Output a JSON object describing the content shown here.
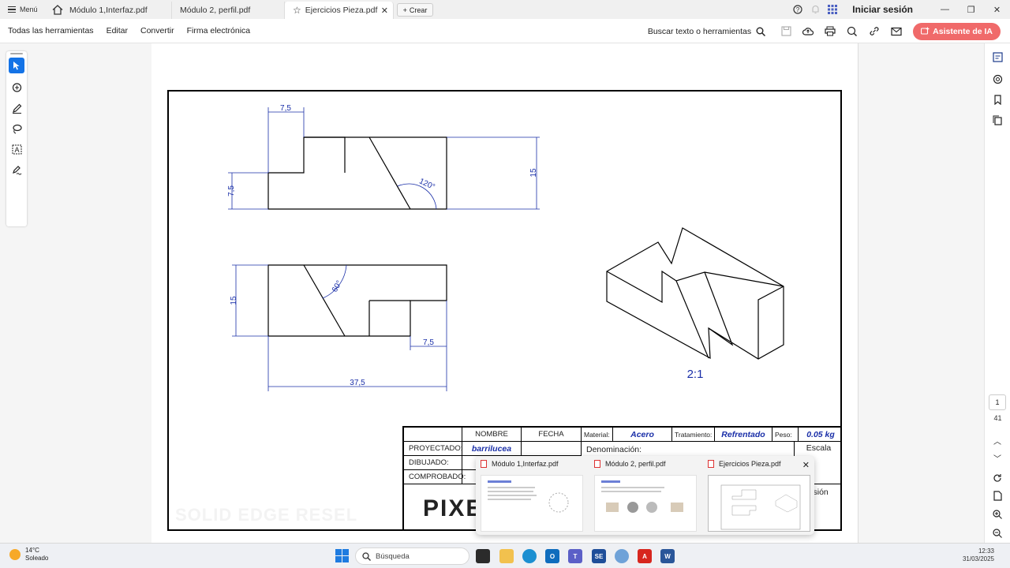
{
  "tabbar": {
    "menu_label": "Menú",
    "tabs": [
      {
        "label": "Módulo 1,Interfaz.pdf"
      },
      {
        "label": "Módulo 2, perfil.pdf"
      },
      {
        "label": "Ejercicios Pieza.pdf"
      }
    ],
    "create_label": "Crear",
    "signin_label": "Iniciar sesión"
  },
  "toolbar": {
    "menus": [
      "Todas las herramientas",
      "Editar",
      "Convertir",
      "Firma electrónica"
    ],
    "search_label": "Buscar texto o herramientas",
    "ai_label": "Asistente de IA"
  },
  "drawing": {
    "dims": {
      "top_75": "7,5",
      "left_75": "7,5",
      "right_15": "15",
      "angle_120": "120°",
      "bottom_15": "15",
      "angle_60": "60°",
      "bottom_75": "7,5",
      "overall_375": "37,5"
    },
    "scale": "2:1"
  },
  "title_block": {
    "nombre": "NOMBRE",
    "fecha": "FECHA",
    "material_label": "Material:",
    "material_value": "Acero",
    "tratamiento_label": "Tratamiento:",
    "tratamiento_value": "Refrentado",
    "peso_label": "Peso:",
    "peso_value": "0.05 kg",
    "proyectado_label": "PROYECTADO:",
    "proyectado_value": "barrilucea",
    "dibujado_label": "DIBUJADO:",
    "comprobado_label": "COMPROBADO:",
    "denominacion_label": "Denominación:",
    "escala_label": "Escala",
    "version_partial": "rsión",
    "logo_partial": "PIXEL",
    "watermark": "SOLID EDGE RESEL"
  },
  "thumbnails": [
    {
      "label": "Módulo 1,Interfaz.pdf"
    },
    {
      "label": "Módulo 2, perfil.pdf"
    },
    {
      "label": "Ejercicios Pieza.pdf"
    }
  ],
  "right_rail": {
    "page": "1",
    "page_count": "41"
  },
  "taskbar": {
    "temp": "14°C",
    "weather": "Soleado",
    "search_placeholder": "Búsqueda",
    "time": "12:33",
    "date": "31/03/2025"
  },
  "colors": {
    "accent": "#1473e6",
    "ai": "#f06a6a",
    "dim_blue": "#1a2fa8"
  }
}
